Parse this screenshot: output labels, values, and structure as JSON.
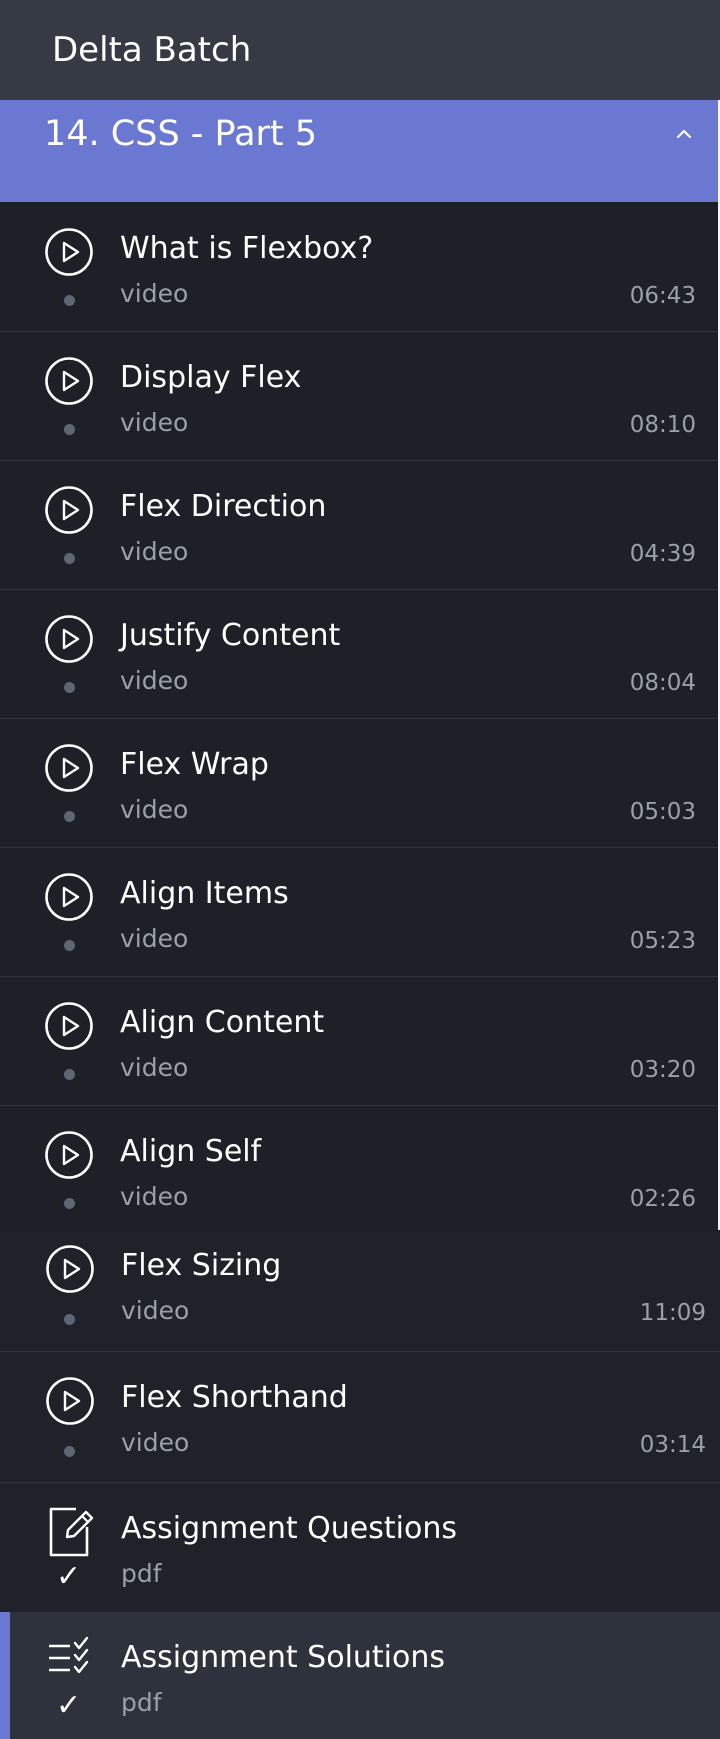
{
  "app": {
    "title": "Delta Batch"
  },
  "section": {
    "title": "14. CSS - Part 5",
    "expanded": true,
    "accent_color": "#6a78d1"
  },
  "lessons": [
    {
      "name": "What is Flexbox?",
      "type": "video",
      "duration": "06:43",
      "icon": "play-circle-icon"
    },
    {
      "name": "Display Flex",
      "type": "video",
      "duration": "08:10",
      "icon": "play-circle-icon"
    },
    {
      "name": "Flex Direction",
      "type": "video",
      "duration": "04:39",
      "icon": "play-circle-icon"
    },
    {
      "name": "Justify Content",
      "type": "video",
      "duration": "08:04",
      "icon": "play-circle-icon"
    },
    {
      "name": "Flex Wrap",
      "type": "video",
      "duration": "05:03",
      "icon": "play-circle-icon"
    },
    {
      "name": "Align Items",
      "type": "video",
      "duration": "05:23",
      "icon": "play-circle-icon"
    },
    {
      "name": "Align Content",
      "type": "video",
      "duration": "03:20",
      "icon": "play-circle-icon"
    },
    {
      "name": "Align Self",
      "type": "video",
      "duration": "02:26",
      "icon": "play-circle-icon"
    },
    {
      "name": "Flex Sizing",
      "type": "video",
      "duration": "11:09",
      "icon": "play-circle-icon"
    },
    {
      "name": "Flex Shorthand",
      "type": "video",
      "duration": "03:14",
      "icon": "play-circle-icon"
    }
  ],
  "assignments": [
    {
      "name": "Assignment Questions",
      "type": "pdf",
      "icon": "assignment-edit-icon",
      "status": "completed-check-icon"
    },
    {
      "name": "Assignment Solutions",
      "type": "pdf",
      "icon": "checklist-icon",
      "status": "completed-check-icon",
      "active": true
    }
  ],
  "check_mark": "✓"
}
